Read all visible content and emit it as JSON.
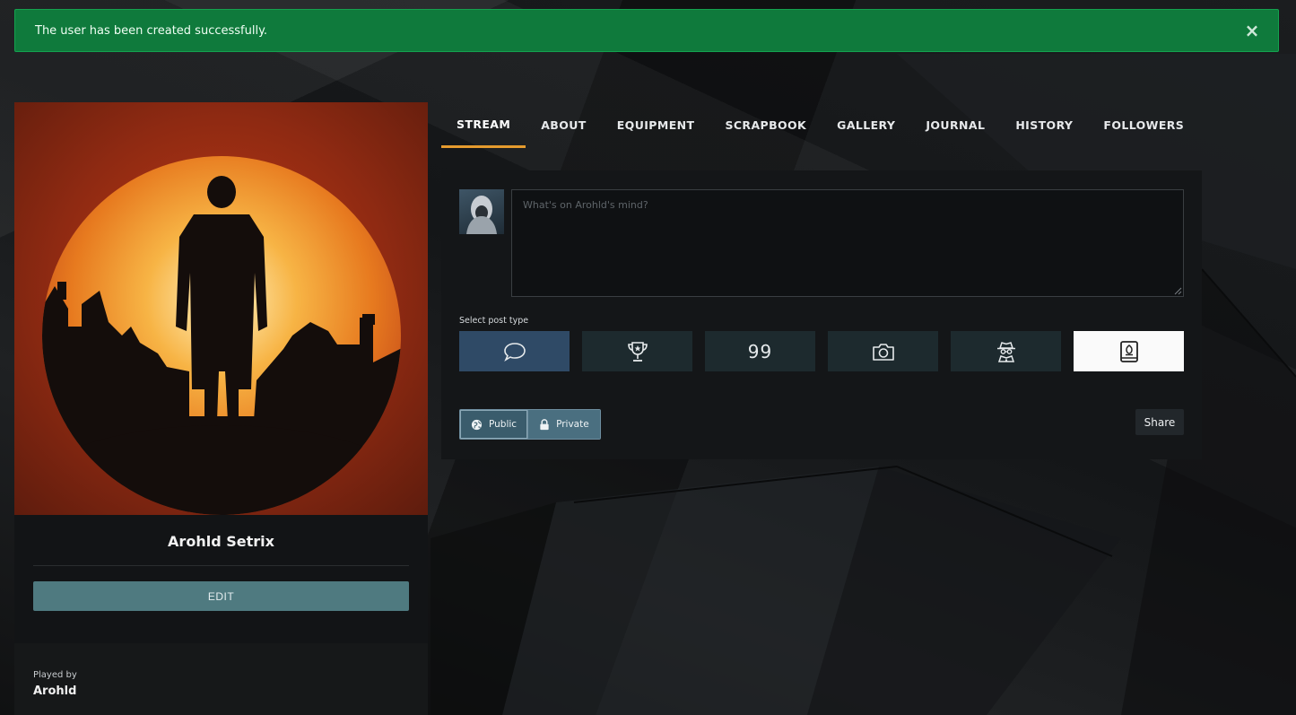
{
  "alert": {
    "message": "The user has been created successfully.",
    "close_glyph": "×"
  },
  "profile": {
    "name": "Arohld Setrix",
    "edit_label": "EDIT",
    "played_by_label": "Played by",
    "played_by_name": "Arohld"
  },
  "tabs": [
    {
      "label": "STREAM",
      "active": true
    },
    {
      "label": "ABOUT"
    },
    {
      "label": "EQUIPMENT"
    },
    {
      "label": "SCRAPBOOK"
    },
    {
      "label": "GALLERY"
    },
    {
      "label": "JOURNAL"
    },
    {
      "label": "HISTORY"
    },
    {
      "label": "FOLLOWERS"
    }
  ],
  "composer": {
    "placeholder": "What's on Arohld's mind?",
    "select_post_type_label": "Select post type",
    "post_types": [
      {
        "icon": "speech-bubble-icon",
        "active": true
      },
      {
        "icon": "trophy-icon"
      },
      {
        "icon": "quote-icon",
        "glyph": "99"
      },
      {
        "icon": "camera-icon"
      },
      {
        "icon": "spy-icon"
      },
      {
        "icon": "journal-book-icon",
        "light": true
      }
    ],
    "privacy": {
      "public_label": "Public",
      "private_label": "Private"
    },
    "share_label": "Share"
  },
  "colors": {
    "alert_bg": "#0f7a3c",
    "tab_active_underline": "#e59b2e",
    "edit_button": "#4f7a80",
    "post_type_active": "#2f4a66"
  }
}
